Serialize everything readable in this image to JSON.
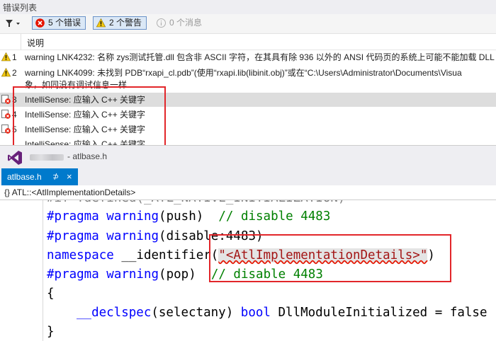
{
  "panel": {
    "title": "错误列表"
  },
  "toolbar": {
    "errors_label": "5 个错误",
    "warnings_label": "2 个警告",
    "messages_label": "0 个消息"
  },
  "column_header": {
    "description": "说明"
  },
  "rows": [
    {
      "num": "1",
      "type": "warning",
      "text": "warning LNK4232: 名称 zys测试托管.dll 包含非 ASCII 字符，在其具有除 936 以外的 ANSI 代码页的系统上可能不能加载 DLL"
    },
    {
      "num": "2",
      "type": "warning",
      "text": "warning LNK4099: 未找到 PDB“rxapi_cl.pdb”(使用“rxapi.lib(libinit.obj)”或在“C:\\Users\\Administrator\\Documents\\Visua",
      "text2": "象，如同没有调试信息一样"
    },
    {
      "num": "3",
      "type": "error",
      "text": "IntelliSense: 应输入 C++ 关键字"
    },
    {
      "num": "4",
      "type": "error",
      "text": "IntelliSense: 应输入 C++ 关键字"
    },
    {
      "num": "5",
      "type": "error",
      "text": "IntelliSense: 应输入 C++ 关键字"
    },
    {
      "num": "",
      "type": "error",
      "text": "IntelliSense: 应输入 C++ 关键字"
    }
  ],
  "editor": {
    "file_caption": "- atlbase.h",
    "tab_label": "atlbase.h",
    "tab_pin": "⊅",
    "tab_close": "×",
    "nav_scope": "{} ATL::<AtlImplementationDetails>"
  },
  "code": {
    "line0": "#if !defined(_ATL_NATIVE_INITIALIZATION)",
    "line1": {
      "pp": "#pragma warning",
      "tx": "(push)  ",
      "cm": "// disable 4483"
    },
    "line2": {
      "pp": "#pragma warning",
      "tx": "(disable:4483)"
    },
    "line3": {
      "kw": "namespace",
      "tx": " __identifier(",
      "st": "\"<AtlImplementationDetails>\"",
      "tx2": ")"
    },
    "line4": {
      "pp": "#pragma warning",
      "tx": "(pop)  ",
      "cm": "// disable 4483"
    },
    "line5": "{",
    "line6": {
      "kw": "__declspec",
      "tx": "(selectany) ",
      "kw2": "bool",
      "tx2": " DllModuleInitialized = false"
    },
    "line7": "}"
  },
  "colors": {
    "accent": "#007acc",
    "highlight_box": "#e2262a",
    "error_red": "#e51400",
    "warning_yellow": "#f2c811"
  }
}
